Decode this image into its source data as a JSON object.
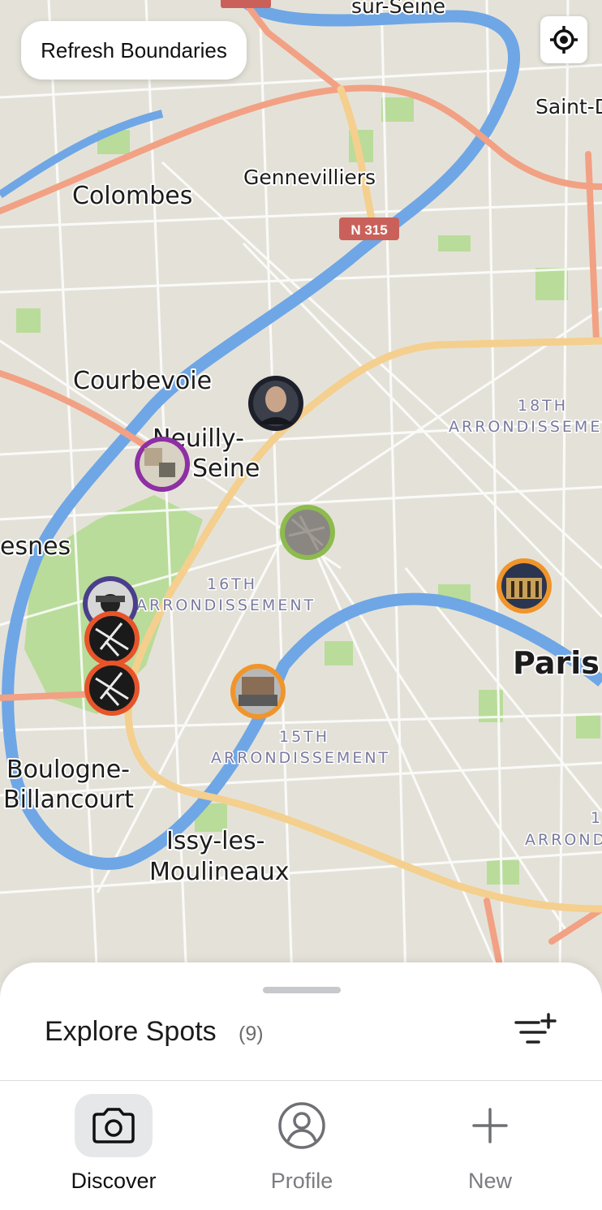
{
  "map": {
    "place_labels": [
      {
        "id": "saint-denis",
        "text": "Saint-D"
      },
      {
        "id": "gennevilliers",
        "text": "Gennevilliers"
      },
      {
        "id": "colombes",
        "text": "Colombes"
      },
      {
        "id": "courbevoie",
        "text": "Courbevoie"
      },
      {
        "id": "neuilly-1",
        "text": "Neuilly-"
      },
      {
        "id": "neuilly-2",
        "text": "Seine"
      },
      {
        "id": "suresnes",
        "text": "esnes"
      },
      {
        "id": "paris",
        "text": "Paris"
      },
      {
        "id": "boulogne-1",
        "text": "Boulogne-"
      },
      {
        "id": "boulogne-2",
        "text": "Billancourt"
      },
      {
        "id": "issy-1",
        "text": "Issy-les-"
      },
      {
        "id": "issy-2",
        "text": "Moulineaux"
      },
      {
        "id": "sur-seine",
        "text": "sur-Seine"
      }
    ],
    "district_labels": [
      {
        "id": "a18-num",
        "text": "18TH"
      },
      {
        "id": "a18-word",
        "text": "ARRONDISSEME"
      },
      {
        "id": "a16-num",
        "text": "16TH"
      },
      {
        "id": "a16-word",
        "text": "ARRONDISSEMENT"
      },
      {
        "id": "a15-num",
        "text": "15TH"
      },
      {
        "id": "a15-word",
        "text": "ARRONDISSEMENT"
      },
      {
        "id": "a-right-num",
        "text": "1"
      },
      {
        "id": "a-right-word",
        "text": "ARROND"
      }
    ],
    "road_shields": [
      {
        "id": "n315",
        "text": "N 315"
      }
    ],
    "spot_ring_colors": {
      "dark": "#1d1f2a",
      "purple": "#8e2fa4",
      "green": "#8dbb4e",
      "orange": "#f0952b",
      "red_orange": "#e8542a",
      "indigo": "#4a3f8a"
    }
  },
  "controls": {
    "refresh_label": "Refresh Boundaries",
    "locate_icon": "crosshair-icon"
  },
  "sheet": {
    "title": "Explore Spots",
    "count": "(9)",
    "filter_icon": "filter-add-icon"
  },
  "tabs": [
    {
      "label": "Discover",
      "icon": "camera-icon",
      "active": true
    },
    {
      "label": "Profile",
      "icon": "user-circle-icon",
      "active": false
    },
    {
      "label": "New",
      "icon": "plus-icon",
      "active": false
    }
  ]
}
